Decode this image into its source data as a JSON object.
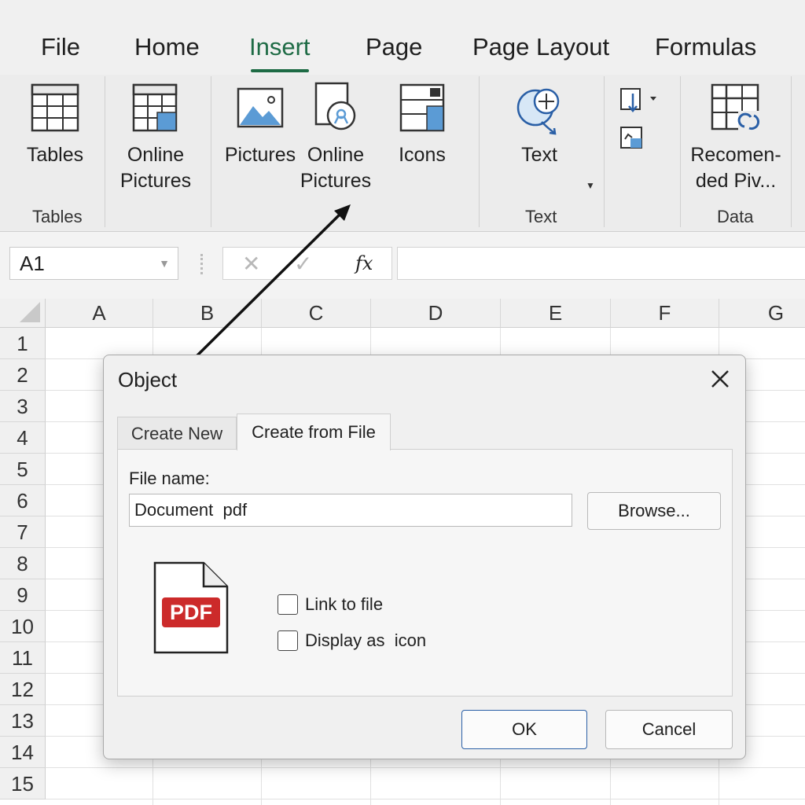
{
  "ribbon_tabs": [
    "File",
    "Home",
    "Insert",
    "Page",
    "Page Layout",
    "Formulas"
  ],
  "active_tab": "Insert",
  "ribbon": {
    "tables_button": "Tables",
    "online_pictures_1": [
      "Online",
      "Pictures"
    ],
    "pictures_button": "Pictures",
    "online_pictures_2": [
      "Online",
      "Pictures"
    ],
    "icons_button": "Icons",
    "text_button": "Text",
    "recommended_button": [
      "Recomen-",
      "ded Piv..."
    ],
    "groups": {
      "tables": "Tables",
      "text": "Text",
      "data": "Data"
    }
  },
  "formula_bar": {
    "name_box": "A1",
    "fx_label": "fx"
  },
  "sheet": {
    "columns": [
      "A",
      "B",
      "C",
      "D",
      "E",
      "F",
      "G"
    ],
    "rows": [
      "1",
      "2",
      "3",
      "4",
      "5",
      "6",
      "7",
      "8",
      "9",
      "10",
      "11",
      "12",
      "13",
      "14",
      "15"
    ]
  },
  "dialog": {
    "title": "Object",
    "tabs": [
      "Create New",
      "Create from File"
    ],
    "active_tab": "Create from File",
    "file_name_label": "File name:",
    "file_name_value": "Document  pdf",
    "browse_label": "Browse...",
    "pdf_badge": "PDF",
    "link_to_file_label": "Link to file",
    "display_as_icon_label": "Display as  icon",
    "ok_label": "OK",
    "cancel_label": "Cancel"
  },
  "colors": {
    "accent_green": "#1e6b45",
    "icon_blue": "#5b9bd5",
    "pdf_red": "#cc2a2a",
    "ok_border": "#2a5fa6"
  }
}
